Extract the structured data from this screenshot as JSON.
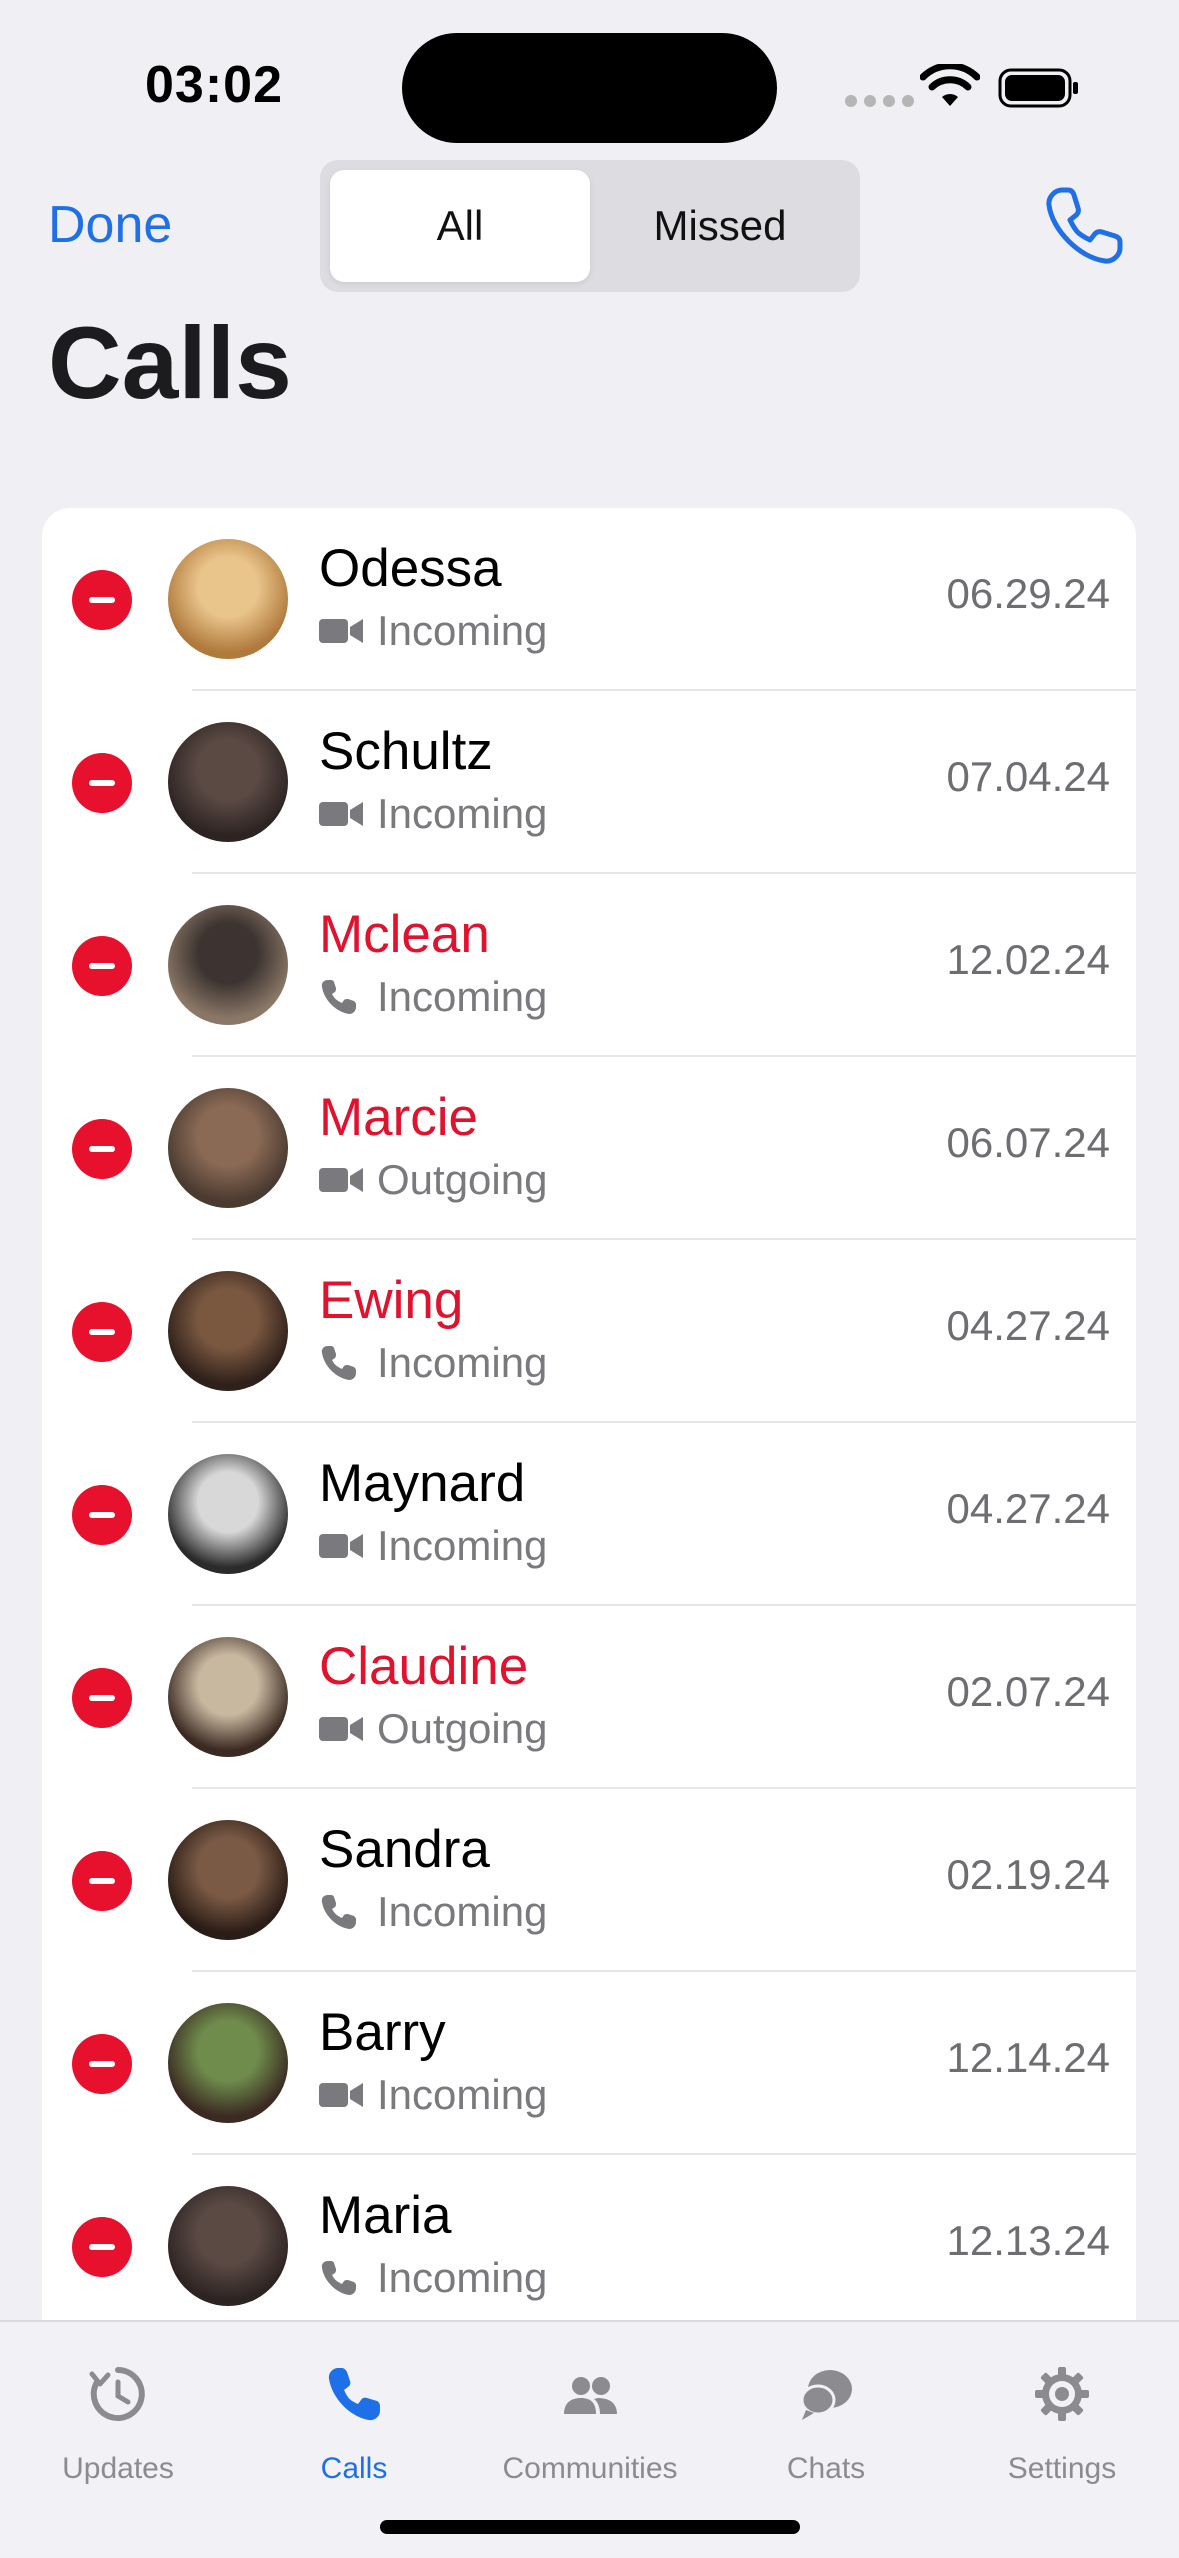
{
  "status_bar": {
    "time": "03:02"
  },
  "nav": {
    "done_label": "Done",
    "segments": [
      "All",
      "Missed"
    ],
    "selected_segment": "All",
    "title": "Calls",
    "accent": "#1E6FE8"
  },
  "calls": [
    {
      "name": "Odessa",
      "type": "Incoming",
      "media": "video",
      "date": "06.29.24",
      "missed": false
    },
    {
      "name": "Schultz",
      "type": "Incoming",
      "media": "video",
      "date": "07.04.24",
      "missed": false
    },
    {
      "name": "Mclean",
      "type": "Incoming",
      "media": "phone",
      "date": "12.02.24",
      "missed": true
    },
    {
      "name": "Marcie",
      "type": "Outgoing",
      "media": "video",
      "date": "06.07.24",
      "missed": true
    },
    {
      "name": "Ewing",
      "type": "Incoming",
      "media": "phone",
      "date": "04.27.24",
      "missed": true
    },
    {
      "name": "Maynard",
      "type": "Incoming",
      "media": "video",
      "date": "04.27.24",
      "missed": false
    },
    {
      "name": "Claudine",
      "type": "Outgoing",
      "media": "video",
      "date": "02.07.24",
      "missed": true
    },
    {
      "name": "Sandra",
      "type": "Incoming",
      "media": "phone",
      "date": "02.19.24",
      "missed": false
    },
    {
      "name": "Barry",
      "type": "Incoming",
      "media": "video",
      "date": "12.14.24",
      "missed": false
    },
    {
      "name": "Maria",
      "type": "Incoming",
      "media": "phone",
      "date": "12.13.24",
      "missed": false
    }
  ],
  "tab_bar": {
    "tabs": [
      {
        "label": "Updates",
        "icon": "updates-icon"
      },
      {
        "label": "Calls",
        "icon": "phone-icon"
      },
      {
        "label": "Communities",
        "icon": "people-icon"
      },
      {
        "label": "Chats",
        "icon": "chat-bubbles-icon"
      },
      {
        "label": "Settings",
        "icon": "gear-icon"
      }
    ],
    "active": "Calls"
  },
  "colors": {
    "missed": "#E0122E",
    "delete": "#E8112D",
    "accent": "#1E6FE8"
  }
}
